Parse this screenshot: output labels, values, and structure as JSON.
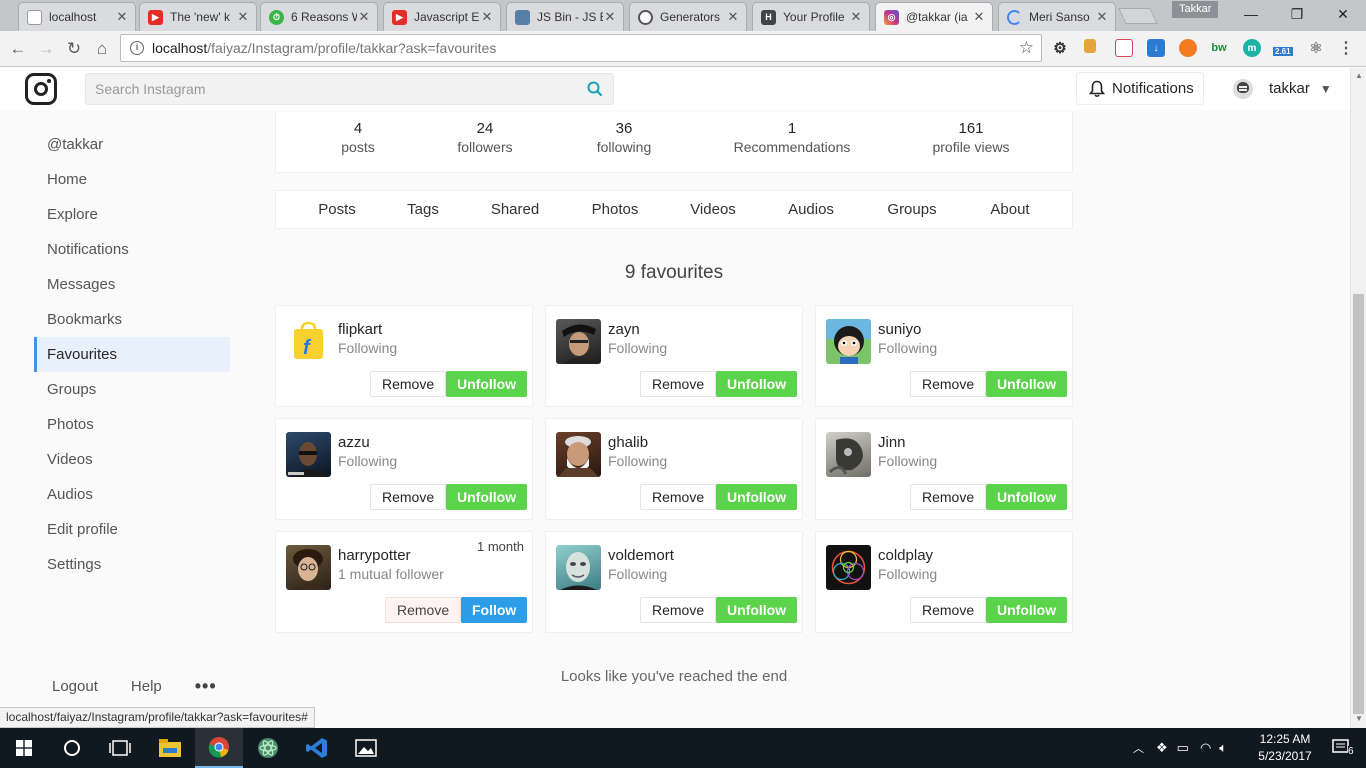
{
  "browser": {
    "tabs": [
      {
        "title": "localhost",
        "icon": "page-icon",
        "color": "#9e9e9e"
      },
      {
        "title": "The 'new' k",
        "icon": "youtube-icon",
        "color": "#e52d27"
      },
      {
        "title": "6 Reasons W",
        "icon": "timer-icon",
        "color": "#3bb54a"
      },
      {
        "title": "Javascript E",
        "icon": "youtube-icon",
        "color": "#e52d27"
      },
      {
        "title": "JS Bin - JS B",
        "icon": "jsbin-icon",
        "color": "#5a7fa6"
      },
      {
        "title": "Generators",
        "icon": "generators-icon",
        "color": "#555555"
      },
      {
        "title": "Your Profile",
        "icon": "hashnode-icon",
        "color": "#444444"
      },
      {
        "title": "@takkar (ia",
        "icon": "instagram-icon",
        "color": "#c13584",
        "active": true
      },
      {
        "title": "Meri Sanso",
        "icon": "loading-icon",
        "color": "#4285f4"
      }
    ],
    "profile_chip": "Takkar",
    "url_host": "localhost",
    "url_path": "/faiyaz/Instagram/profile/takkar?ask=favourites",
    "status_url": "localhost/faiyaz/Instagram/profile/takkar?ask=favourites#",
    "extension_badge": "2.61"
  },
  "header": {
    "search_placeholder": "Search Instagram",
    "notifications_label": "Notifications",
    "username": "takkar"
  },
  "sidebar": {
    "items": [
      {
        "label": "@takkar"
      },
      {
        "label": "Home"
      },
      {
        "label": "Explore"
      },
      {
        "label": "Notifications"
      },
      {
        "label": "Messages"
      },
      {
        "label": "Bookmarks"
      },
      {
        "label": "Favourites",
        "active": true
      },
      {
        "label": "Groups"
      },
      {
        "label": "Photos"
      },
      {
        "label": "Videos"
      },
      {
        "label": "Audios"
      },
      {
        "label": "Edit profile"
      },
      {
        "label": "Settings"
      }
    ],
    "footer": {
      "logout": "Logout",
      "help": "Help",
      "more": "•••"
    }
  },
  "stats": [
    {
      "num": "4",
      "label": "posts"
    },
    {
      "num": "24",
      "label": "followers"
    },
    {
      "num": "36",
      "label": "following"
    },
    {
      "num": "1",
      "label": "Recommendations"
    },
    {
      "num": "161",
      "label": "profile views"
    }
  ],
  "profile_tabs": [
    "Posts",
    "Tags",
    "Shared",
    "Photos",
    "Videos",
    "Audios",
    "Groups",
    "About"
  ],
  "favourites": {
    "heading": "9 favourites",
    "remove_label": "Remove",
    "unfollow_label": "Unfollow",
    "follow_label": "Follow",
    "items": [
      {
        "name": "flipkart",
        "sub": "Following"
      },
      {
        "name": "zayn",
        "sub": "Following"
      },
      {
        "name": "suniyo",
        "sub": "Following"
      },
      {
        "name": "azzu",
        "sub": "Following"
      },
      {
        "name": "ghalib",
        "sub": "Following"
      },
      {
        "name": "Jinn",
        "sub": "Following"
      },
      {
        "name": "harrypotter",
        "sub": "1 mutual follower",
        "time": "1 month"
      },
      {
        "name": "voldemort",
        "sub": "Following"
      },
      {
        "name": "coldplay",
        "sub": "Following"
      }
    ],
    "end_text": "Looks like you've reached the end"
  },
  "taskbar": {
    "time": "12:25 AM",
    "date": "5/23/2017",
    "notification_count": "6"
  },
  "colors": {
    "follow_green": "#5bd34b",
    "follow_blue": "#2e9de8",
    "active_sidebar": "#e8f0fb",
    "accent_teal": "#17a2b8"
  }
}
